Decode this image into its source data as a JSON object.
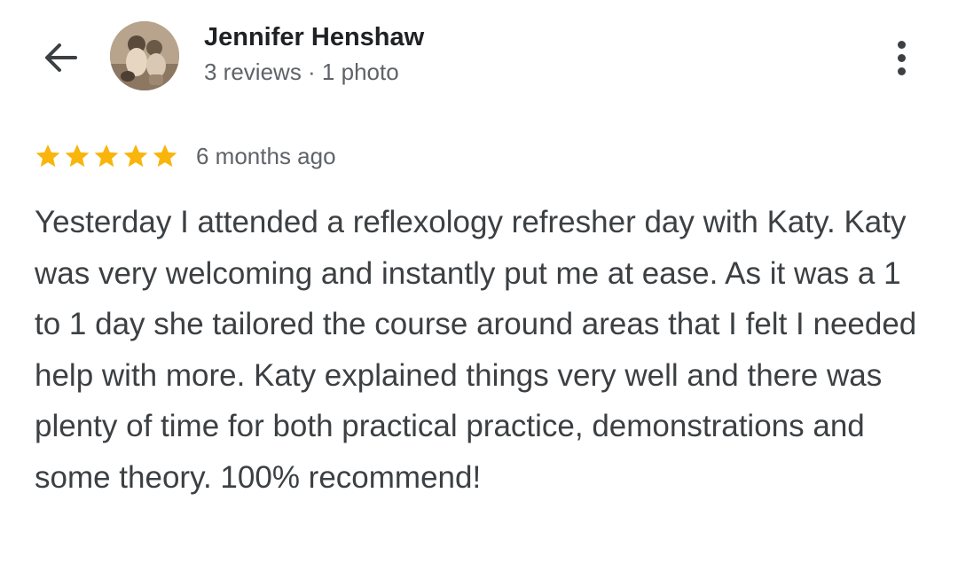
{
  "header": {
    "author_name": "Jennifer Henshaw",
    "author_meta": "3 reviews · 1 photo",
    "back_icon": "arrow-left-icon",
    "more_icon": "more-vert-icon"
  },
  "review": {
    "rating": 5,
    "rating_max": 5,
    "date": "6 months ago",
    "text": "Yesterday I attended a reflexology refresher day with Katy. Katy was very welcoming and instantly put me at ease. As it was a 1 to 1 day she tailored the course around areas that I felt I needed help with more. Katy explained things very well and there was plenty of time for both practical practice, demonstrations and some theory. 100% recommend!"
  },
  "colors": {
    "star": "#F9B50B",
    "name_text": "#202124",
    "meta_text": "#5F6368",
    "body_text": "#3C4043",
    "background": "#FFFFFF"
  }
}
